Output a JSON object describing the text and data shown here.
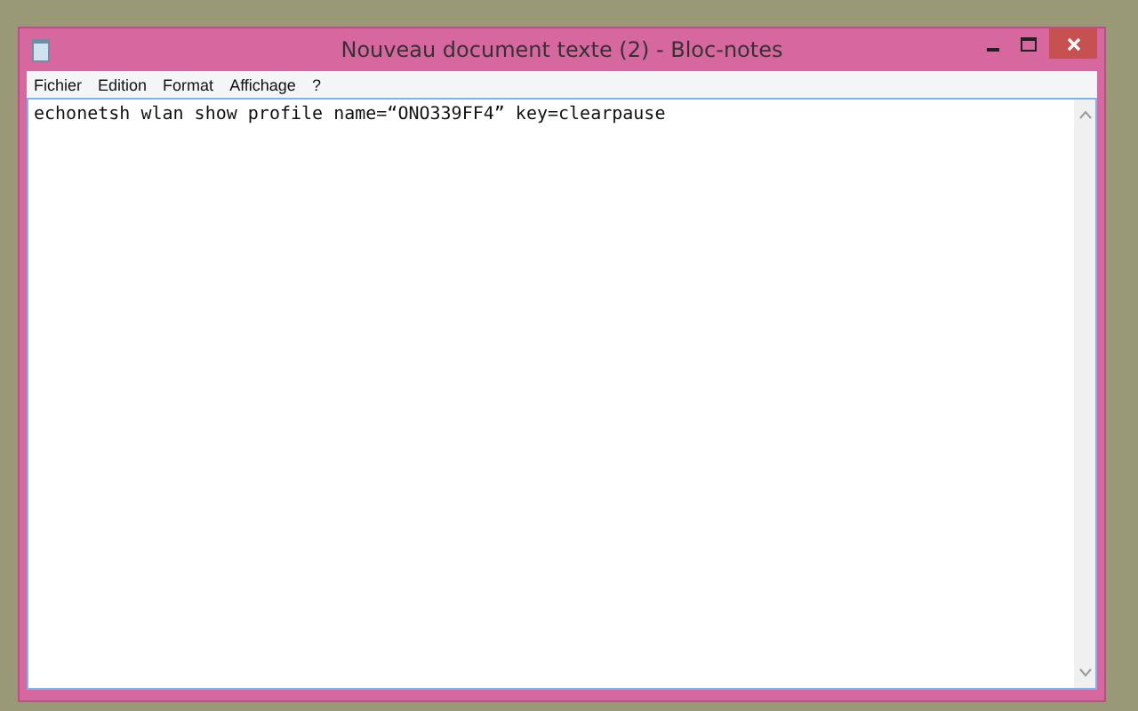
{
  "window": {
    "title": "Nouveau document texte (2) - Bloc-notes"
  },
  "menu": [
    "Fichier",
    "Edition",
    "Format",
    "Affichage",
    "?"
  ],
  "editor": {
    "text": "echonetsh wlan show profile name=“ONO339FF4” key=clearpause"
  }
}
